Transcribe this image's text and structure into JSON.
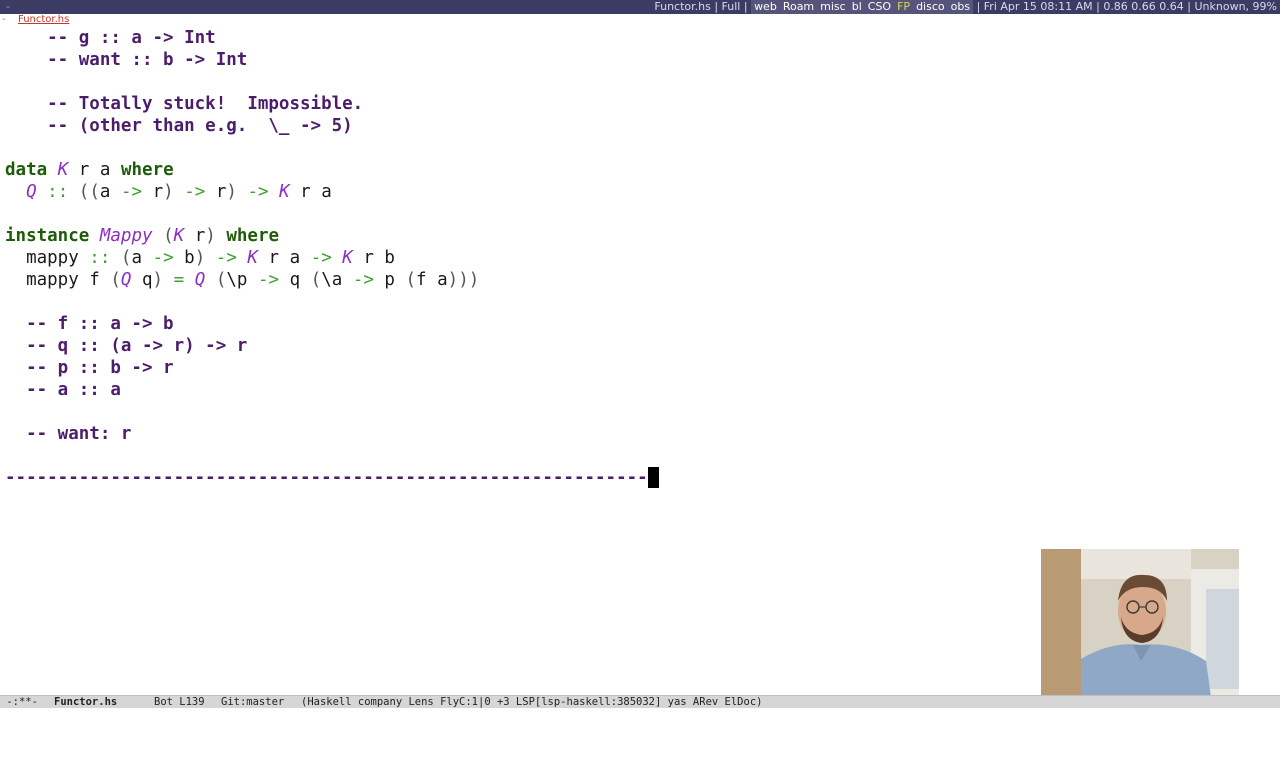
{
  "top_bar": {
    "left_text": "-",
    "title": "Functor.hs | Full |",
    "workspaces": [
      "web",
      "Roam",
      "misc",
      "bl",
      "CSO",
      "FP",
      "disco",
      "obs"
    ],
    "active_workspace": "FP",
    "status": "| Fri Apr 15  08:11 AM | 0.86 0.66 0.64 | Unknown, 99%"
  },
  "tab": {
    "marker": "-",
    "file": "Functor.hs"
  },
  "code_lines": [
    [
      [
        "c",
        "    -- g :: a -> Int"
      ]
    ],
    [
      [
        "c",
        "    -- want :: b -> Int"
      ]
    ],
    [
      [
        "id",
        ""
      ]
    ],
    [
      [
        "c",
        "    -- Totally stuck!  Impossible."
      ]
    ],
    [
      [
        "c",
        "    -- (other than e.g.  \\_ -> 5)"
      ]
    ],
    [
      [
        "id",
        ""
      ]
    ],
    [
      [
        "kw",
        "data"
      ],
      [
        "id",
        " "
      ],
      [
        "ty",
        "K"
      ],
      [
        "id",
        " r a "
      ],
      [
        "kw",
        "where"
      ]
    ],
    [
      [
        "id",
        "  "
      ],
      [
        "ty",
        "Q"
      ],
      [
        "id",
        " "
      ],
      [
        "op",
        "::"
      ],
      [
        "id",
        " "
      ],
      [
        "pr",
        "(("
      ],
      [
        "id",
        "a "
      ],
      [
        "op",
        "->"
      ],
      [
        "id",
        " r"
      ],
      [
        "pr",
        ")"
      ],
      [
        "id",
        " "
      ],
      [
        "op",
        "->"
      ],
      [
        "id",
        " r"
      ],
      [
        "pr",
        ")"
      ],
      [
        "id",
        " "
      ],
      [
        "op",
        "->"
      ],
      [
        "id",
        " "
      ],
      [
        "ty",
        "K"
      ],
      [
        "id",
        " r a"
      ]
    ],
    [
      [
        "id",
        ""
      ]
    ],
    [
      [
        "kw",
        "instance"
      ],
      [
        "id",
        " "
      ],
      [
        "ty",
        "Mappy"
      ],
      [
        "id",
        " "
      ],
      [
        "pr",
        "("
      ],
      [
        "ty",
        "K"
      ],
      [
        "id",
        " r"
      ],
      [
        "pr",
        ")"
      ],
      [
        "id",
        " "
      ],
      [
        "kw",
        "where"
      ]
    ],
    [
      [
        "id",
        "  mappy "
      ],
      [
        "op",
        "::"
      ],
      [
        "id",
        " "
      ],
      [
        "pr",
        "("
      ],
      [
        "id",
        "a "
      ],
      [
        "op",
        "->"
      ],
      [
        "id",
        " b"
      ],
      [
        "pr",
        ")"
      ],
      [
        "id",
        " "
      ],
      [
        "op",
        "->"
      ],
      [
        "id",
        " "
      ],
      [
        "ty",
        "K"
      ],
      [
        "id",
        " r a "
      ],
      [
        "op",
        "->"
      ],
      [
        "id",
        " "
      ],
      [
        "ty",
        "K"
      ],
      [
        "id",
        " r b"
      ]
    ],
    [
      [
        "id",
        "  mappy f "
      ],
      [
        "pr",
        "("
      ],
      [
        "ty",
        "Q"
      ],
      [
        "id",
        " q"
      ],
      [
        "pr",
        ")"
      ],
      [
        "id",
        " "
      ],
      [
        "op",
        "="
      ],
      [
        "id",
        " "
      ],
      [
        "ty",
        "Q"
      ],
      [
        "id",
        " "
      ],
      [
        "pr",
        "("
      ],
      [
        "id",
        "\\p "
      ],
      [
        "op",
        "->"
      ],
      [
        "id",
        " q "
      ],
      [
        "pr",
        "("
      ],
      [
        "id",
        "\\a "
      ],
      [
        "op",
        "->"
      ],
      [
        "id",
        " p "
      ],
      [
        "pr",
        "("
      ],
      [
        "id",
        "f a"
      ],
      [
        "pr",
        ")))"
      ]
    ],
    [
      [
        "id",
        ""
      ]
    ],
    [
      [
        "c",
        "  -- f :: a -> b"
      ]
    ],
    [
      [
        "c",
        "  -- q :: (a -> r) -> r"
      ]
    ],
    [
      [
        "c",
        "  -- p :: b -> r"
      ]
    ],
    [
      [
        "c",
        "  -- a :: a"
      ]
    ],
    [
      [
        "id",
        ""
      ]
    ],
    [
      [
        "c",
        "  -- want: r"
      ]
    ],
    [
      [
        "id",
        ""
      ]
    ],
    [
      [
        "c",
        "-------------------------------------------------------------"
      ]
    ]
  ],
  "modeline": {
    "state": " -:**-",
    "buffer": "Functor.hs",
    "position": "Bot L139",
    "vc": "Git:master",
    "modes": "(Haskell company Lens FlyC:1|0 +3 LSP[lsp-haskell:385032] yas ARev ElDoc)"
  }
}
